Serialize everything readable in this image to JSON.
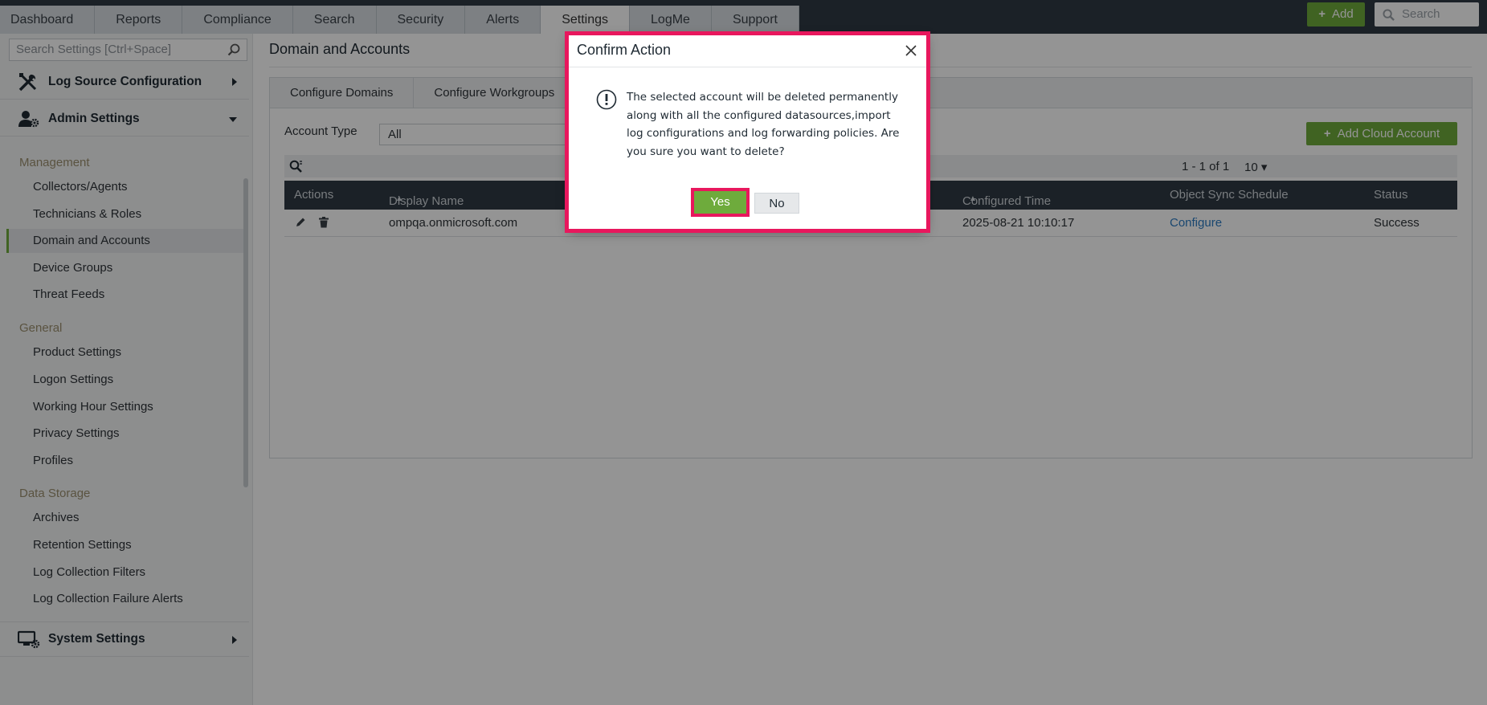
{
  "nav": {
    "tabs": [
      "Dashboard",
      "Reports",
      "Compliance",
      "Search",
      "Security",
      "Alerts",
      "Settings",
      "LogMe",
      "Support"
    ],
    "active_tab": "Settings",
    "add_label": "Add",
    "search_placeholder": "Search"
  },
  "sidebar": {
    "search_placeholder": "Search Settings [Ctrl+Space]",
    "log_source": "Log Source Configuration",
    "admin": "Admin Settings",
    "groups": {
      "management": "Management",
      "general": "General",
      "storage": "Data Storage"
    },
    "management_items": [
      "Collectors/Agents",
      "Technicians & Roles",
      "Domain and Accounts",
      "Device Groups",
      "Threat Feeds"
    ],
    "general_items": [
      "Product Settings",
      "Logon Settings",
      "Working Hour Settings",
      "Privacy Settings",
      "Profiles"
    ],
    "storage_items": [
      "Archives",
      "Retention Settings",
      "Log Collection Filters",
      "Log Collection Failure Alerts"
    ],
    "system": "System Settings",
    "active_item": "Domain and Accounts"
  },
  "main": {
    "title": "Domain and Accounts",
    "subtabs": [
      "Configure Domains",
      "Configure Workgroups"
    ],
    "account_type_label": "Account Type",
    "account_type_value": "All",
    "add_cloud_label": "Add Cloud Account",
    "pager": "1 - 1 of 1",
    "page_size": "10",
    "columns": {
      "actions": "Actions",
      "display_name": "Display Name",
      "configured_time": "Configured Time",
      "object_sync": "Object Sync Schedule",
      "status": "Status"
    },
    "row": {
      "display_name": "ompqa.onmicrosoft.com",
      "configured_time": "2025-08-21 10:10:17",
      "object_sync": "Configure",
      "status": "Success"
    }
  },
  "dialog": {
    "title": "Confirm Action",
    "message": "The selected account will be deleted permanently along with all the configured datasources,import log configurations and log forwarding policies. Are you sure you want to delete?",
    "yes": "Yes",
    "no": "No"
  },
  "colors": {
    "accent_green": "#6eab3c",
    "highlight_pink": "#e8175d",
    "nav_dark": "#2f3a44",
    "link_blue": "#2b7bc2"
  }
}
